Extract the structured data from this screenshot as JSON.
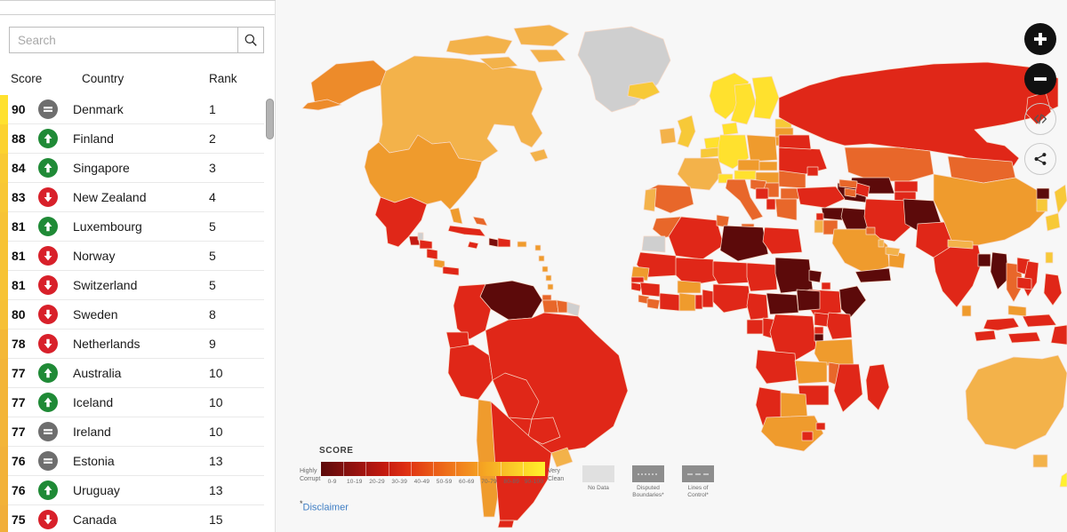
{
  "search": {
    "placeholder": "Search",
    "value": "",
    "icon": "search-icon"
  },
  "table": {
    "headers": {
      "score": "Score",
      "country": "Country",
      "rank": "Rank"
    },
    "rows": [
      {
        "score": "90",
        "country": "Denmark",
        "rank": "1",
        "trend": "same",
        "bar": "#ffe12e"
      },
      {
        "score": "88",
        "country": "Finland",
        "rank": "2",
        "trend": "up",
        "bar": "#fcd22e"
      },
      {
        "score": "84",
        "country": "Singapore",
        "rank": "3",
        "trend": "up",
        "bar": "#f9ca32"
      },
      {
        "score": "83",
        "country": "New Zealand",
        "rank": "4",
        "trend": "down",
        "bar": "#f8c734"
      },
      {
        "score": "81",
        "country": "Luxembourg",
        "rank": "5",
        "trend": "up",
        "bar": "#f7c335"
      },
      {
        "score": "81",
        "country": "Norway",
        "rank": "5",
        "trend": "down",
        "bar": "#f7c335"
      },
      {
        "score": "81",
        "country": "Switzerland",
        "rank": "5",
        "trend": "down",
        "bar": "#f7c335"
      },
      {
        "score": "80",
        "country": "Sweden",
        "rank": "8",
        "trend": "down",
        "bar": "#f6c036"
      },
      {
        "score": "78",
        "country": "Netherlands",
        "rank": "9",
        "trend": "down",
        "bar": "#f4b837"
      },
      {
        "score": "77",
        "country": "Australia",
        "rank": "10",
        "trend": "up",
        "bar": "#f3b538"
      },
      {
        "score": "77",
        "country": "Iceland",
        "rank": "10",
        "trend": "up",
        "bar": "#f3b538"
      },
      {
        "score": "77",
        "country": "Ireland",
        "rank": "10",
        "trend": "same",
        "bar": "#f3b538"
      },
      {
        "score": "76",
        "country": "Estonia",
        "rank": "13",
        "trend": "same",
        "bar": "#f2b239"
      },
      {
        "score": "76",
        "country": "Uruguay",
        "rank": "13",
        "trend": "up",
        "bar": "#f2b239"
      },
      {
        "score": "75",
        "country": "Canada",
        "rank": "15",
        "trend": "down",
        "bar": "#f1af3a"
      }
    ]
  },
  "map": {
    "controls": [
      {
        "name": "zoom-in-button",
        "icon": "plus-icon",
        "style": "solid"
      },
      {
        "name": "zoom-out-button",
        "icon": "minus-icon",
        "style": "solid"
      },
      {
        "name": "embed-button",
        "icon": "code-icon",
        "style": "ghost"
      },
      {
        "name": "share-button",
        "icon": "share-nodes-icon",
        "style": "ghost"
      }
    ],
    "legend": {
      "title": "SCORE",
      "left_label": "Highly\nCorrupt",
      "right_label": "Very\nClean",
      "ticks": [
        "0-9",
        "10-19",
        "20-29",
        "30-39",
        "40-49",
        "50-59",
        "60-69",
        "70-79",
        "80-89",
        "90-100"
      ],
      "symbols": [
        {
          "label": "No Data",
          "kind": "nodata"
        },
        {
          "label": "Disputed Boundaries*",
          "kind": "disputed"
        },
        {
          "label": "Lines of Control*",
          "kind": "loc"
        }
      ]
    },
    "disclaimer": {
      "star": "*",
      "text": "Disclaimer"
    },
    "background": "#f7f7f7",
    "no_data_color": "#cfcfcf"
  }
}
